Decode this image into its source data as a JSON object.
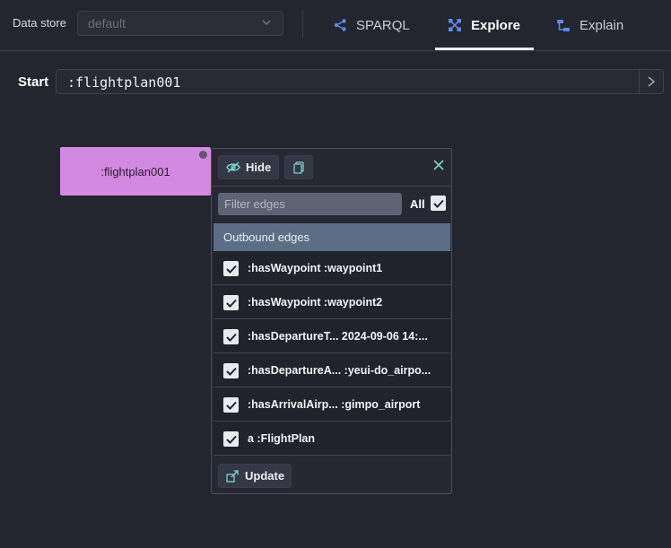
{
  "topbar": {
    "data_store_label": "Data store",
    "data_store_value": "default",
    "tabs": [
      {
        "label": "SPARQL",
        "icon": "share-nodes-icon"
      },
      {
        "label": "Explore",
        "icon": "graph-explore-icon",
        "active": true
      },
      {
        "label": "Explain",
        "icon": "tree-structure-icon"
      }
    ]
  },
  "start": {
    "label": "Start",
    "value": ":flightplan001"
  },
  "node": {
    "label": ":flightplan001",
    "color": "#d18ae0"
  },
  "panel": {
    "hide_label": "Hide",
    "filter_placeholder": "Filter edges",
    "all_label": "All",
    "all_checked": true,
    "section_title": "Outbound edges",
    "edges": [
      {
        "text": ":hasWaypoint :waypoint1",
        "checked": true
      },
      {
        "text": ":hasWaypoint :waypoint2",
        "checked": true
      },
      {
        "text": ":hasDepartureT... 2024-09-06 14:...",
        "checked": true
      },
      {
        "text": ":hasDepartureA... :yeui-do_airpo...",
        "checked": true
      },
      {
        "text": ":hasArrivalAirp... :gimpo_airport",
        "checked": true
      },
      {
        "text": "a :FlightPlan",
        "checked": true
      }
    ],
    "update_label": "Update"
  },
  "colors": {
    "background": "#23252f",
    "accent_teal": "#7fd3c6",
    "tab_icon_blue": "#5b8be6",
    "section_header": "#5c6e86"
  }
}
